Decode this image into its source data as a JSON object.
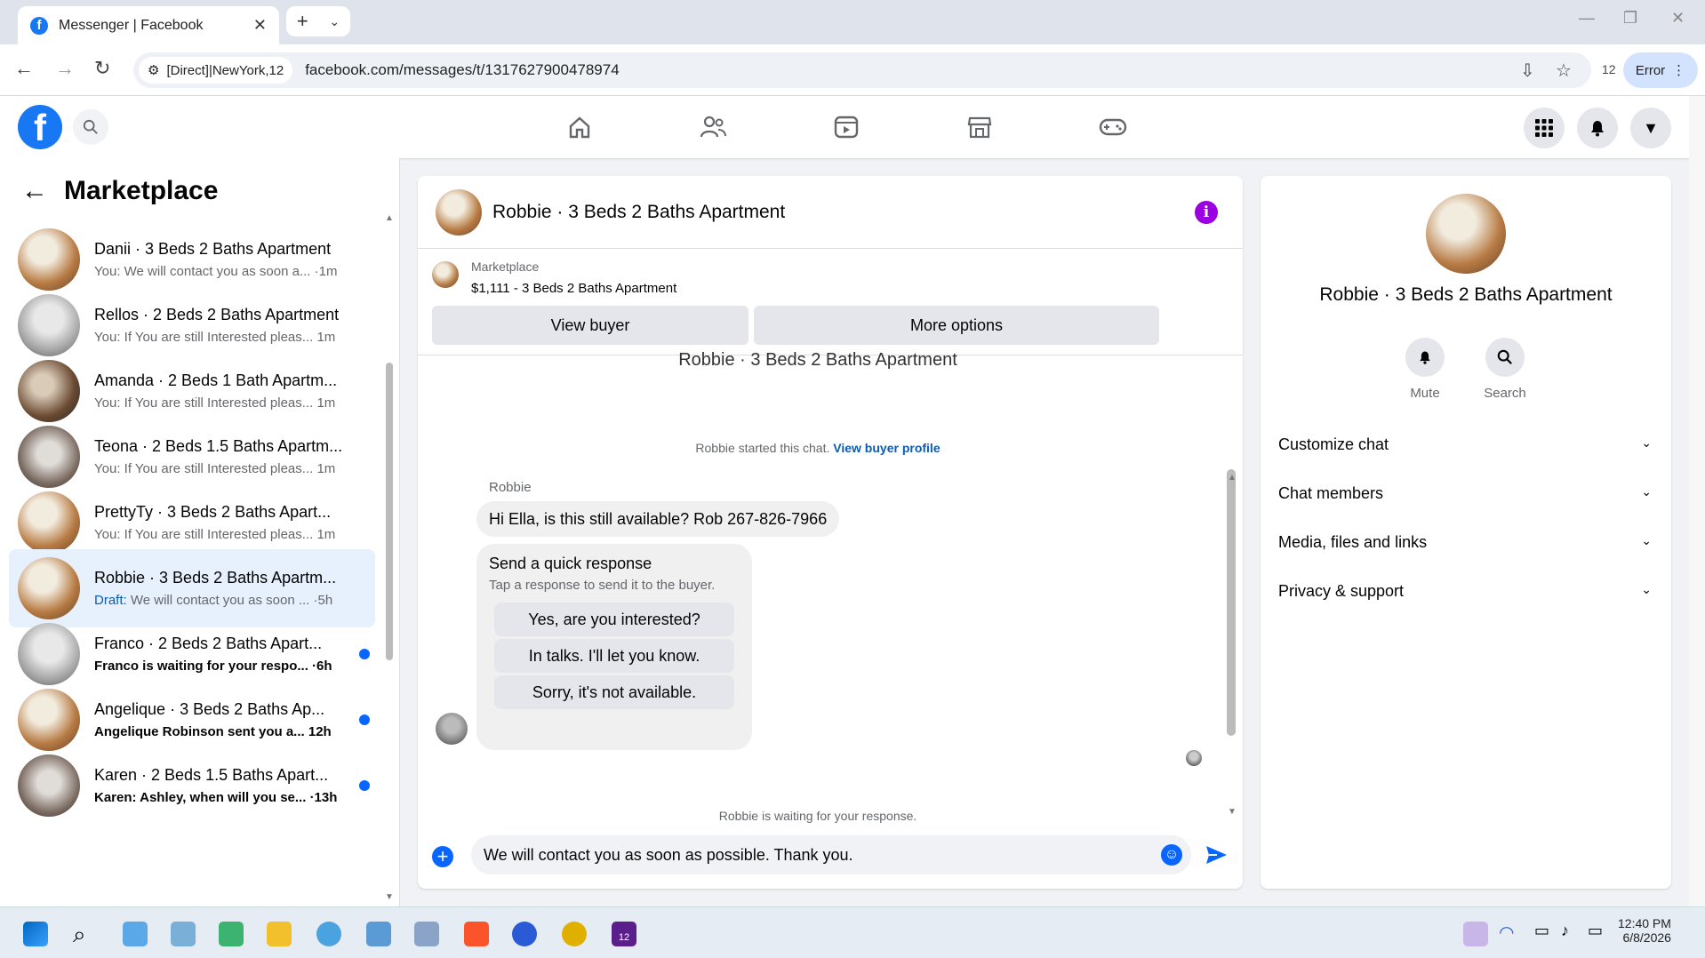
{
  "browser": {
    "tab_title": "Messenger | Facebook",
    "address_chip": "[Direct]|NewYork,12",
    "url": "facebook.com/messages/t/1317627900478974",
    "badge_count": "12",
    "error_label": "Error"
  },
  "sidebar": {
    "title": "Marketplace",
    "conversations": [
      {
        "name": "Danii · 3 Beds 2 Baths Apartment",
        "preview": "You: We will contact you as soon a... ·1m",
        "unread": false,
        "selected": false
      },
      {
        "name": "Rellos · 2 Beds 2 Baths Apartment",
        "preview": "You: If You are still Interested pleas... 1m",
        "unread": false,
        "selected": false
      },
      {
        "name": "Amanda · 2 Beds 1 Bath Apartm...",
        "preview": "You: If You are still Interested pleas... 1m",
        "unread": false,
        "selected": false
      },
      {
        "name": "Teona · 2 Beds 1.5 Baths Apartm...",
        "preview": "You: If You are still Interested pleas... 1m",
        "unread": false,
        "selected": false
      },
      {
        "name": "PrettyTy · 3 Beds 2 Baths Apart...",
        "preview": "You: If You are still Interested pleas... 1m",
        "unread": false,
        "selected": false
      },
      {
        "name": "Robbie · 3 Beds 2 Baths Apartm...",
        "preview_label": "Draft:",
        "preview": "We will contact you as soon ... ·5h",
        "unread": false,
        "selected": true
      },
      {
        "name": "Franco · 2 Beds 2 Baths Apart...",
        "preview": "Franco is waiting for your respo... ·6h",
        "unread": true,
        "selected": false
      },
      {
        "name": "Angelique · 3 Beds 2 Baths Ap...",
        "preview": "Angelique Robinson sent you a... 12h",
        "unread": true,
        "selected": false
      },
      {
        "name": "Karen · 2 Beds 1.5 Baths Apart...",
        "preview": "Karen: Ashley, when will you se... ·13h",
        "unread": true,
        "selected": false
      }
    ]
  },
  "chat": {
    "title": "Robbie · 3 Beds 2 Baths Apartment",
    "marketplace_label": "Marketplace",
    "listing": "$1,111 - 3 Beds 2 Baths Apartment",
    "view_buyer": "View buyer",
    "more_options": "More options",
    "scrolled_title": "Robbie · 3 Beds 2 Baths Apartment",
    "started_text": "Robbie started this chat.",
    "view_profile": "View buyer profile",
    "sender": "Robbie",
    "message": "Hi Ella, is this still available? Rob 267-826-7966",
    "quick_title": "Send a quick response",
    "quick_sub": "Tap a response to send it to the buyer.",
    "quick_replies": [
      "Yes, are you interested?",
      "In talks. I'll let you know.",
      "Sorry, it's not available."
    ],
    "waiting": "Robbie is waiting for your response.",
    "draft": "We will contact you as soon as possible. Thank you."
  },
  "details": {
    "name": "Robbie · 3 Beds 2 Baths Apartment",
    "mute": "Mute",
    "search": "Search",
    "sections": [
      "Customize chat",
      "Chat members",
      "Media, files and links",
      "Privacy & support"
    ]
  },
  "taskbar": {
    "time": "12:40 PM",
    "date": "6/8/2026",
    "badge": "12"
  },
  "colors": {
    "fb_blue": "#1877f2",
    "messenger_blue": "#0866ff",
    "selected_bg": "#e7f0fd",
    "info_purple": "#9b00e0"
  }
}
